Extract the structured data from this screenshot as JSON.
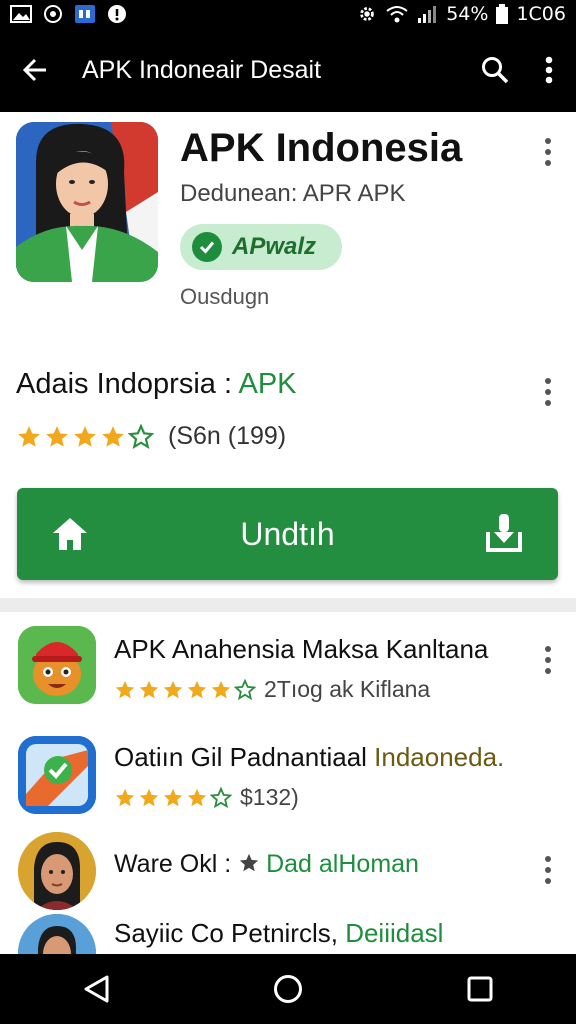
{
  "status_bar": {
    "battery": "54%",
    "time": "1C06"
  },
  "app_bar": {
    "title": "APK Indoneair Desait"
  },
  "app": {
    "name": "APK Indonesia",
    "developer": "Dedunean: APR APK",
    "badge": "APwalz",
    "subtitle": "Ousdugn"
  },
  "info": {
    "title": "Adais Indoprsia : ",
    "title_accent": "APK",
    "rating": 4,
    "rating_text": "(S6n (199)"
  },
  "install_button": {
    "label": "Undtıh"
  },
  "list": [
    {
      "title": "APK Anahensia Maksa Kanltana",
      "rating": 5,
      "sub": "2Tıog ak Kiflana"
    },
    {
      "title": "Oatiın Gil Padnantiaal ",
      "title_accent": "Indaoneda.",
      "rating": 4,
      "sub": "$132)"
    },
    {
      "title": "Ware Okl : ",
      "title_accent": "Dad alHoman"
    },
    {
      "title": "Sayiic Co Petnircls, ",
      "title_accent": "Deiiidasl"
    }
  ],
  "colors": {
    "brand_green": "#238e3f",
    "star": "#f2a81d",
    "chip_bg": "#c8eccf"
  },
  "icons": [
    "back-arrow-icon",
    "search-icon",
    "more-vert-icon",
    "home-icon",
    "download-icon",
    "star-icon",
    "nav-back-icon",
    "nav-home-icon",
    "nav-recents-icon"
  ]
}
